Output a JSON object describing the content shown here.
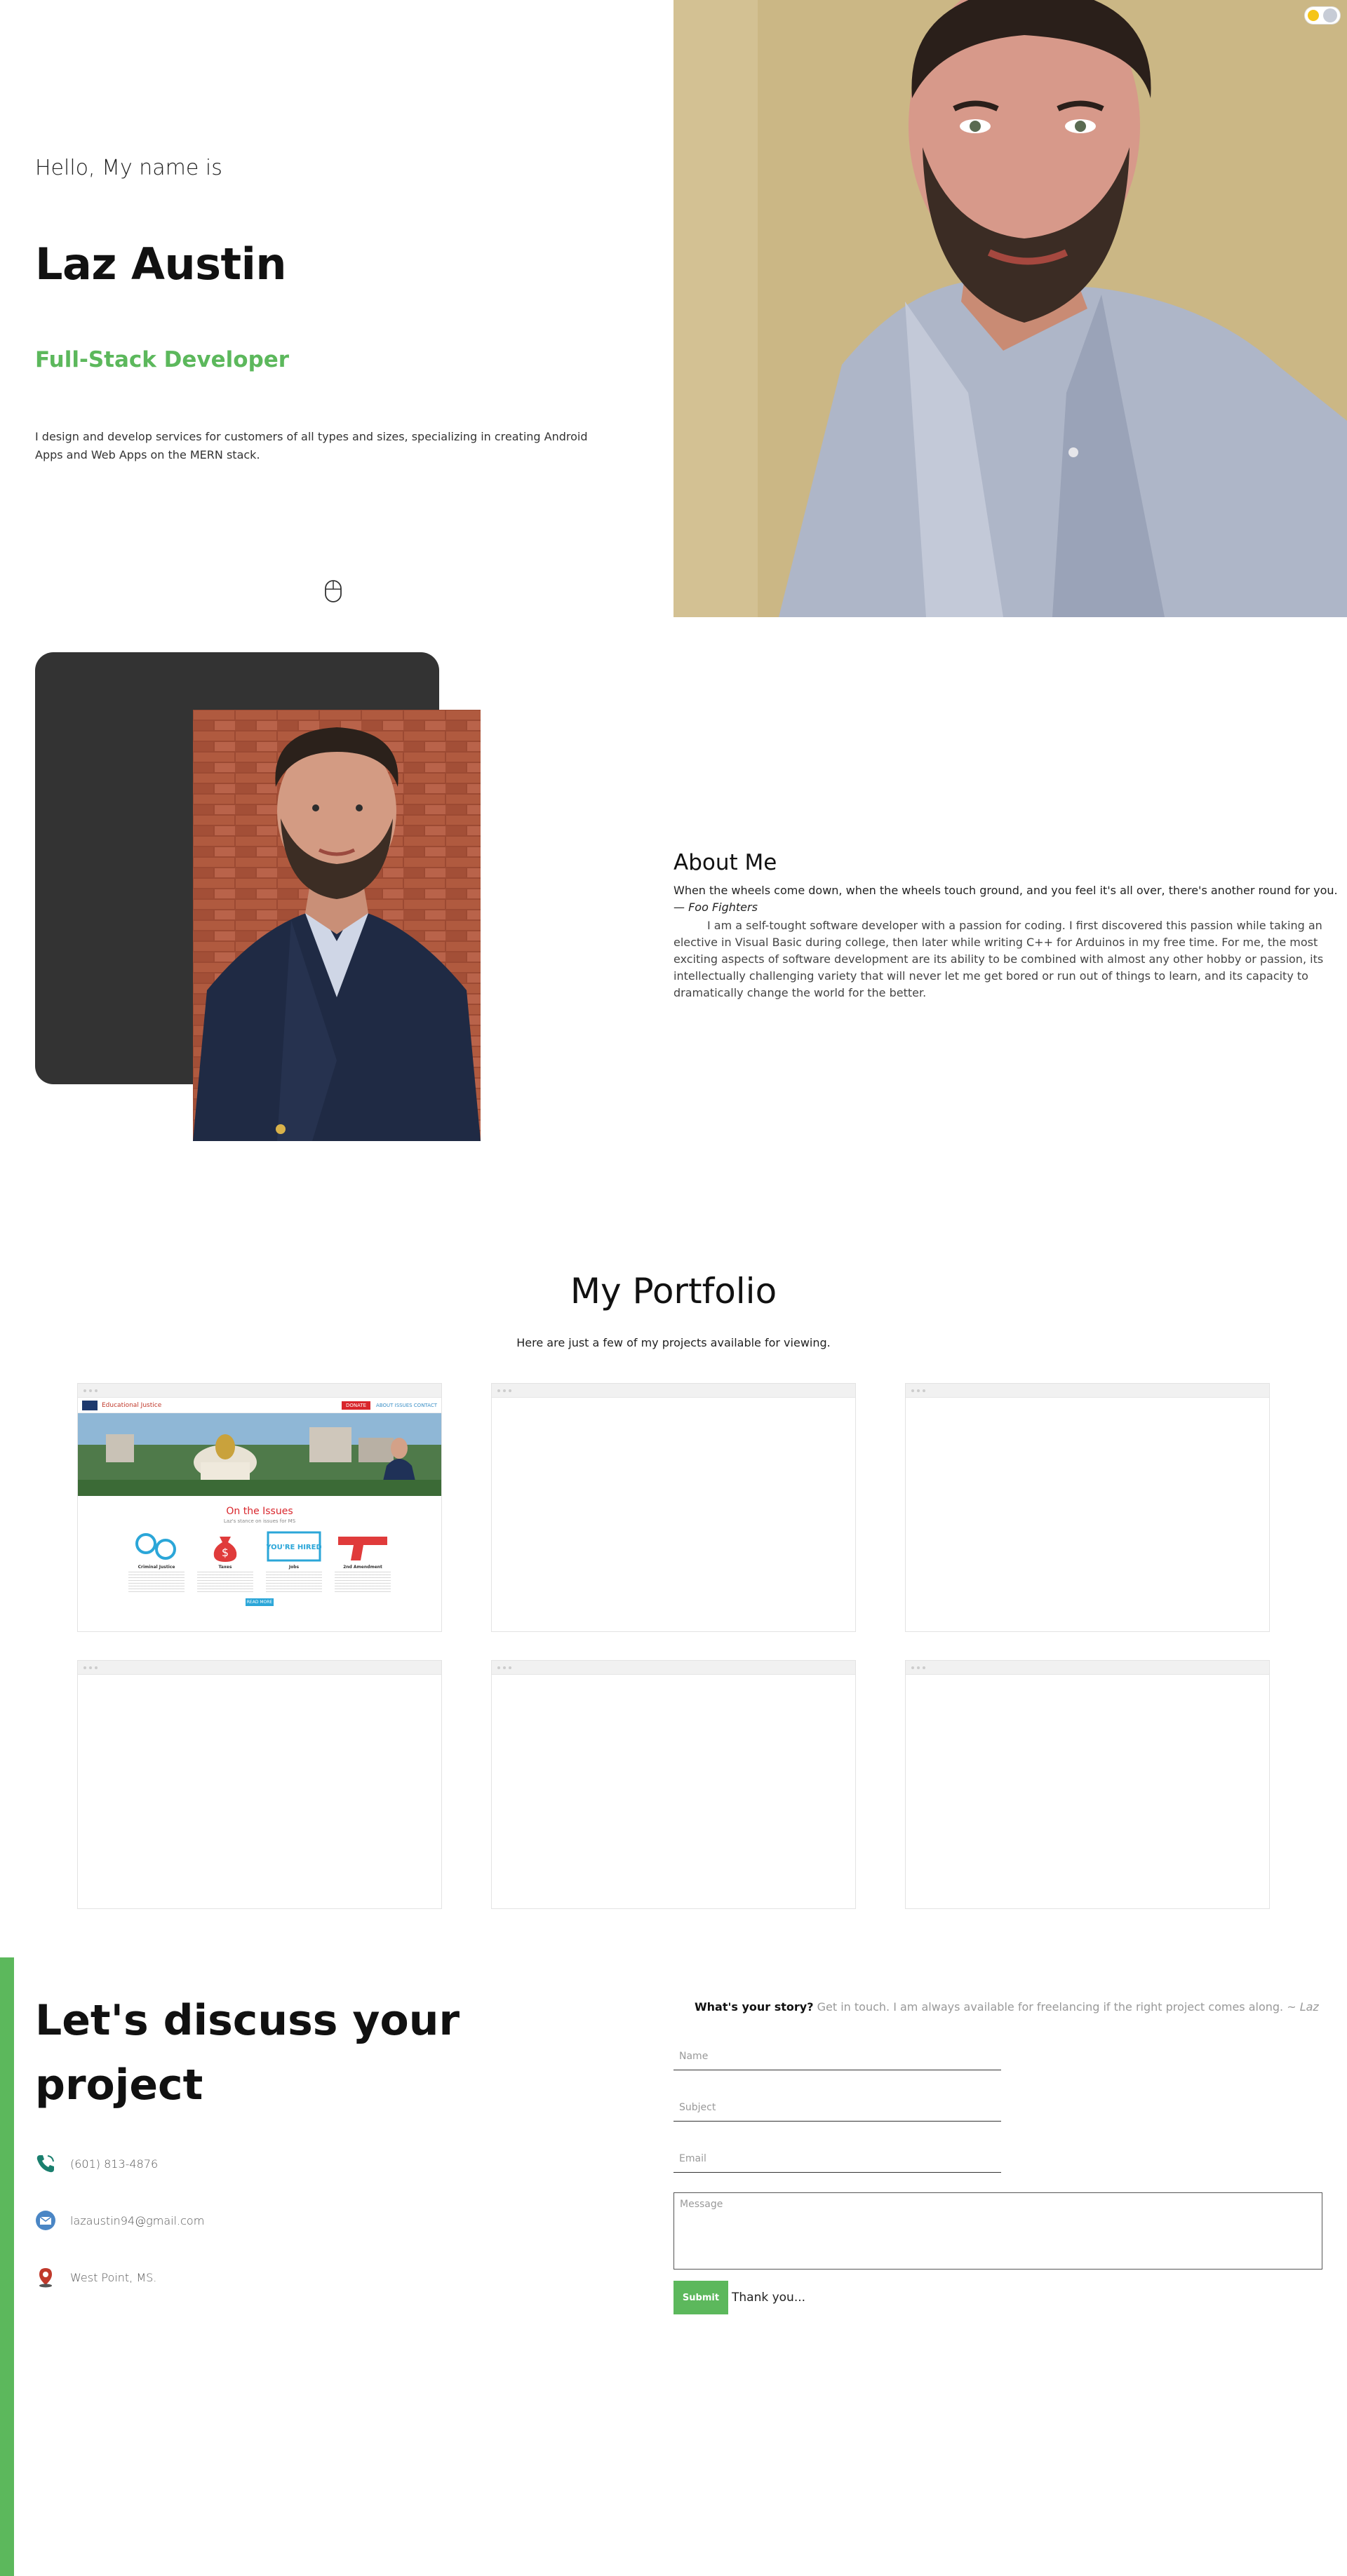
{
  "hero": {
    "greeting": "Hello, My name is",
    "name": "Laz Austin",
    "role": "Full-Stack Developer",
    "intro": "I design and develop services for customers of all types and sizes, specializing in creating Android Apps and Web Apps on the MERN stack."
  },
  "about": {
    "title": "About Me",
    "quote": "When the wheels come down, when the wheels touch ground, and you feel it's all over, there's another round for you.",
    "quote_author": "— Foo Fighters",
    "bio": "I am a self-tought software developer with a passion for coding. I first discovered this passion while taking an elective in Visual Basic during college, then later while writing C++ for Arduinos in my free time. For me, the most exciting aspects of software development are its ability to be combined with almost any other hobby or passion, its intellectually challenging variety that will never let me get bored or run out of things to learn, and its capacity to dramatically change the world for the better."
  },
  "portfolio": {
    "title": "My Portfolio",
    "subtitle": "Here are just a few of my projects available for viewing.",
    "project1": {
      "brand": "Educational Justice",
      "donate": "DONATE",
      "links": "ABOUT   ISSUES   CONTACT",
      "issues_title": "On the Issues",
      "issues_sub": "Laz's stance on issues for MS",
      "items": [
        "Criminal Justice",
        "Taxes",
        "Jobs",
        "2nd Amendment"
      ],
      "hired_text": "YOU'RE HIRED",
      "more": "READ MORE"
    }
  },
  "contact": {
    "title": "Let's discuss your project",
    "phone": "(601) 813-4876",
    "email": "lazaustin94@gmail.com",
    "location": "West Point, MS.",
    "story_label": "What's your story?",
    "story_text": "Get in touch. I am always available for freelancing if the right project comes along.",
    "story_sign": "~ Laz",
    "name_placeholder": "Name",
    "subject_placeholder": "Subject",
    "email_placeholder": "Email",
    "message_placeholder": "Message",
    "submit_label": "Submit",
    "thanks": "Thank you..."
  },
  "colors": {
    "accent": "#5cb85c",
    "dark_frame": "#333333"
  },
  "icons": [
    "computer-mouse-icon",
    "theme-toggle-icon",
    "phone-icon",
    "email-icon",
    "location-pin-icon"
  ]
}
